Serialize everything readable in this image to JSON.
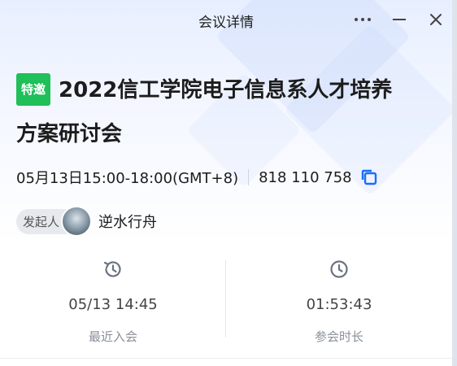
{
  "window": {
    "title": "会议详情"
  },
  "meeting": {
    "tag": "特邀",
    "title_line1": "2022信工学院电子信息系人才培养",
    "title_line2": "方案研讨会",
    "time": "05月13日15:00-18:00(GMT+8)",
    "meeting_id": "818 110 758"
  },
  "host": {
    "label": "发起人",
    "name": "逆水行舟"
  },
  "stats": [
    {
      "value": "05/13 14:45",
      "label": "最近入会",
      "icon": "history-icon"
    },
    {
      "value": "01:53:43",
      "label": "参会时长",
      "icon": "clock-icon"
    }
  ],
  "colors": {
    "tag": "#1fbf5a",
    "copy": "#1a6cff"
  }
}
